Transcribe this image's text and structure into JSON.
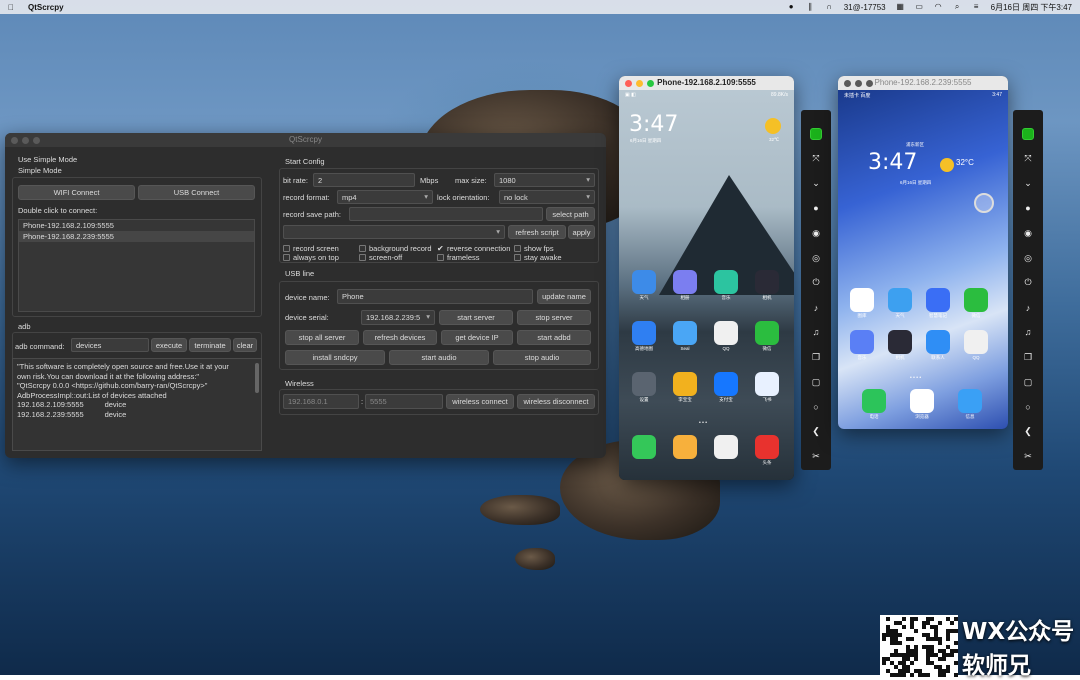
{
  "menubar": {
    "apple": "",
    "app_name": "QtScrcpy",
    "status_text": "31@-17753",
    "datetime": "6月16日 周四 下午3:47"
  },
  "qt": {
    "title": "QtScrcpy",
    "use_simple_mode": "Use Simple Mode",
    "simple_mode": "Simple Mode",
    "wifi_connect": "WIFI Connect",
    "usb_connect": "USB Connect",
    "double_click": "Double click to connect:",
    "devices": [
      "Phone-192.168.2.109:5555",
      "Phone-192.168.2.239:5555"
    ],
    "adb_label": "adb",
    "adb_command_label": "adb command:",
    "adb_command_value": "devices",
    "execute": "execute",
    "terminate": "terminate",
    "clear": "clear",
    "log": [
      "\"This software is completely open source and free.Use it at your",
      "own risk.You can download it at the following address:\"",
      "",
      "\"QtScrcpy 0.0.0 <https://github.com/barry-ran/QtScrcpy>\"",
      "",
      "AdbProcessImpl::out:List of devices attached",
      "192.168.2.109:5555          device",
      "192.168.2.239:5555          device"
    ],
    "start_config": "Start Config",
    "bit_rate_label": "bit rate:",
    "bit_rate_value": "2",
    "mbps": "Mbps",
    "max_size_label": "max size:",
    "max_size_value": "1080",
    "record_format_label": "record format:",
    "record_format_value": "mp4",
    "lock_orientation_label": "lock orientation:",
    "lock_orientation_value": "no lock",
    "record_save_path_label": "record save path:",
    "select_path": "select path",
    "refresh_script": "refresh script",
    "apply": "apply",
    "checks": {
      "record_screen": "record screen",
      "background_record": "background record",
      "reverse_connection": "reverse connection",
      "show_fps": "show fps",
      "always_on_top": "always on top",
      "screen_off": "screen-off",
      "frameless": "frameless",
      "stay_awake": "stay awake"
    },
    "usb_line": "USB line",
    "device_name_label": "device name:",
    "device_name_value": "Phone",
    "update_name": "update name",
    "device_serial_label": "device serial:",
    "device_serial_value": "192.168.2.239:5",
    "start_server": "start server",
    "stop_server": "stop server",
    "stop_all_server": "stop all server",
    "refresh_devices": "refresh devices",
    "get_device_ip": "get device IP",
    "start_adbd": "start adbd",
    "install_sndcpy": "install sndcpy",
    "start_audio": "start audio",
    "stop_audio": "stop audio",
    "wireless": "Wireless",
    "ip_placeholder": "192.168.0.1",
    "colon": ":",
    "port_placeholder": "5555",
    "wireless_connect": "wireless connect",
    "wireless_disconnect": "wireless disconnect"
  },
  "phone1": {
    "title": "Phone-192.168.2.109:5555",
    "status_right": "89.8K/s",
    "clock": "3:47",
    "date": "6月16日 星期四",
    "weather": "32℃",
    "apps": [
      {
        "label": "天气",
        "color": "#3d8be8"
      },
      {
        "label": "相册",
        "color": "#7b7ef0"
      },
      {
        "label": "音乐",
        "color": "#2cc4a0"
      },
      {
        "label": "相机",
        "color": "#2a2a36"
      },
      {
        "label": "高德地图",
        "color": "#2f7ff2"
      },
      {
        "label": "Seal",
        "color": "#4aa6f5"
      },
      {
        "label": "QQ",
        "color": "#f0f0f0"
      },
      {
        "label": "微信",
        "color": "#2bbd3f"
      },
      {
        "label": "设置",
        "color": "#5a6470"
      },
      {
        "label": "李宝宝",
        "color": "#f2b11e"
      },
      {
        "label": "支付宝",
        "color": "#1677ff"
      },
      {
        "label": "飞书",
        "color": "#e8f1ff"
      },
      {
        "label": "",
        "color": "#34c759"
      },
      {
        "label": "",
        "color": "#f7b03c"
      },
      {
        "label": "",
        "color": "#f0f0f0"
      },
      {
        "label": "头条",
        "color": "#e8322e"
      }
    ]
  },
  "phone2": {
    "title": "Phone-192.168.2.239:5555",
    "status_left": "未插卡 百度",
    "status_right": "3:47",
    "clock": "3:47",
    "date": "6月16日 星期四",
    "location": "浦东新区",
    "weather": "32°C",
    "apps": [
      {
        "label": "图库",
        "color": "#ffffff"
      },
      {
        "label": "天气",
        "color": "#3da0f0"
      },
      {
        "label": "智慧笔记",
        "color": "#3a6ef5"
      },
      {
        "label": "微信",
        "color": "#2bbd3f"
      },
      {
        "label": "音乐",
        "color": "#5a7ff5"
      },
      {
        "label": "相机",
        "color": "#2a2a36"
      },
      {
        "label": "联系人",
        "color": "#2f8ef5"
      },
      {
        "label": "QQ",
        "color": "#f0f0f0"
      },
      {
        "label": "电话",
        "color": "#2cc45a"
      },
      {
        "label": "浏览器",
        "color": "#ffffff"
      },
      {
        "label": "信息",
        "color": "#3aa0f5"
      }
    ]
  },
  "toolbar_icons": [
    "power-status-icon",
    "fullscreen-icon",
    "collapse-icon",
    "dot-icon",
    "eye-icon",
    "eye-off-icon",
    "power-icon",
    "volume-up-icon",
    "volume-down-icon",
    "copy-icon",
    "square-icon",
    "circle-icon",
    "back-icon",
    "scissors-icon"
  ],
  "watermark": {
    "line1": "WX公众号",
    "line2": "软师兄"
  }
}
